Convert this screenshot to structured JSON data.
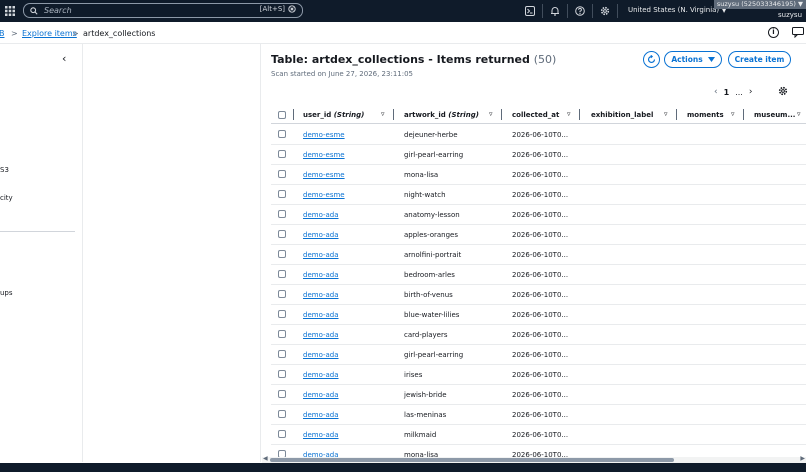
{
  "topbar": {
    "search_placeholder": "Search",
    "shortcut": "[Alt+S]",
    "region": "United States (N. Virginia) ▼",
    "account_id": "suzysu (525033346195) ▼",
    "user": "suzysu"
  },
  "breadcrumb": {
    "root": "B",
    "explore": "Explore items",
    "current": "artdex_collections"
  },
  "leftnav": {
    "items": [
      "S3",
      "city",
      "ups"
    ]
  },
  "table_panel": {
    "title": "Table: artdex_collections - Items returned",
    "count": "(50)",
    "scan_info": "Scan started on June 27, 2026, 23:11:05",
    "actions_label": "Actions",
    "create_label": "Create item",
    "page": "1",
    "ellipsis": "..."
  },
  "columns": {
    "user_id": "user_id",
    "user_id_type": "(String)",
    "artwork_id": "artwork_id",
    "artwork_id_type": "(String)",
    "collected_at": "collected_at",
    "exhibition_label": "exhibition_label",
    "moments": "moments",
    "museum": "museum..."
  },
  "rows": [
    {
      "user_id": "demo-esme",
      "artwork_id": "dejeuner-herbe",
      "collected_at": "2026-06-10T0..."
    },
    {
      "user_id": "demo-esme",
      "artwork_id": "girl-pearl-earring",
      "collected_at": "2026-06-10T0..."
    },
    {
      "user_id": "demo-esme",
      "artwork_id": "mona-lisa",
      "collected_at": "2026-06-10T0..."
    },
    {
      "user_id": "demo-esme",
      "artwork_id": "night-watch",
      "collected_at": "2026-06-10T0..."
    },
    {
      "user_id": "demo-ada",
      "artwork_id": "anatomy-lesson",
      "collected_at": "2026-06-10T0..."
    },
    {
      "user_id": "demo-ada",
      "artwork_id": "apples-oranges",
      "collected_at": "2026-06-10T0..."
    },
    {
      "user_id": "demo-ada",
      "artwork_id": "arnolfini-portrait",
      "collected_at": "2026-06-10T0..."
    },
    {
      "user_id": "demo-ada",
      "artwork_id": "bedroom-arles",
      "collected_at": "2026-06-10T0..."
    },
    {
      "user_id": "demo-ada",
      "artwork_id": "birth-of-venus",
      "collected_at": "2026-06-10T0..."
    },
    {
      "user_id": "demo-ada",
      "artwork_id": "blue-water-lilies",
      "collected_at": "2026-06-10T0..."
    },
    {
      "user_id": "demo-ada",
      "artwork_id": "card-players",
      "collected_at": "2026-06-10T0..."
    },
    {
      "user_id": "demo-ada",
      "artwork_id": "girl-pearl-earring",
      "collected_at": "2026-06-10T0..."
    },
    {
      "user_id": "demo-ada",
      "artwork_id": "irises",
      "collected_at": "2026-06-10T0..."
    },
    {
      "user_id": "demo-ada",
      "artwork_id": "jewish-bride",
      "collected_at": "2026-06-10T0..."
    },
    {
      "user_id": "demo-ada",
      "artwork_id": "las-meninas",
      "collected_at": "2026-06-10T0..."
    },
    {
      "user_id": "demo-ada",
      "artwork_id": "milkmaid",
      "collected_at": "2026-06-10T0..."
    },
    {
      "user_id": "demo-ada",
      "artwork_id": "mona-lisa",
      "collected_at": "2026-06-10T0..."
    }
  ],
  "colors": {
    "nav_bg": "#0f1b2a",
    "link": "#0972d3",
    "text": "#16191f"
  }
}
